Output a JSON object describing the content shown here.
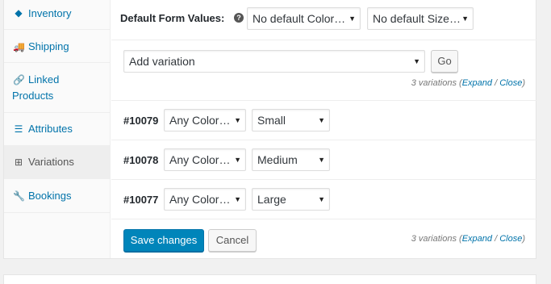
{
  "sidebar": {
    "items": [
      {
        "label": "Inventory",
        "icon": "inventory-icon",
        "glyph": "◆"
      },
      {
        "label": "Shipping",
        "icon": "truck-icon",
        "glyph": "🚚"
      },
      {
        "label": "Linked Products",
        "icon": "link-icon",
        "glyph": "🔗"
      },
      {
        "label": "Attributes",
        "icon": "list-icon",
        "glyph": "☰"
      },
      {
        "label": "Variations",
        "icon": "grid-icon",
        "glyph": "⊞"
      },
      {
        "label": "Bookings",
        "icon": "wrench-icon",
        "glyph": "🔧"
      }
    ]
  },
  "defaults": {
    "label": "Default Form Values:",
    "help_glyph": "?",
    "color_select": "No default Color…",
    "size_select": "No default Size…"
  },
  "add_variation": {
    "select": "Add variation",
    "go_label": "Go"
  },
  "summary": {
    "count_text": "3 variations",
    "open_paren": "(",
    "expand": "Expand",
    "sep": " / ",
    "close": "Close",
    "close_paren": ")"
  },
  "variations": [
    {
      "id": "#10079",
      "color": "Any Color…",
      "size": "Small"
    },
    {
      "id": "#10078",
      "color": "Any Color…",
      "size": "Medium"
    },
    {
      "id": "#10077",
      "color": "Any Color…",
      "size": "Large"
    }
  ],
  "footer": {
    "save_label": "Save changes",
    "cancel_label": "Cancel"
  },
  "colors": {
    "link": "#0073aa",
    "primary": "#0085ba"
  }
}
